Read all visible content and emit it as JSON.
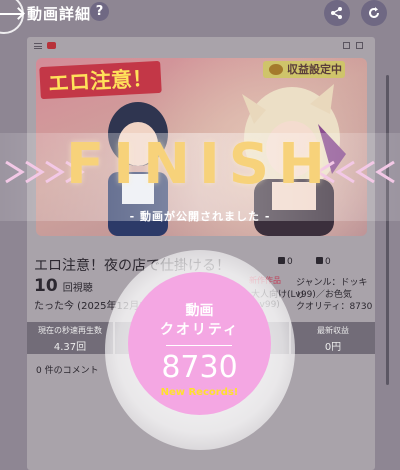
{
  "header": {
    "title": "動画詳細",
    "help_label": "?"
  },
  "video": {
    "thumbnail_banner": "エロ注意！",
    "monetize_badge": "収益設定中",
    "title": "エロ注意！夜の店で仕掛ける！",
    "views_count": "10",
    "views_label": "回視聴",
    "posted_time": "たった今 (2025年12月12日)",
    "likes": "0",
    "dislikes": "0",
    "badge_text": "新作作品",
    "genre": "ジャンル：ドッキリ",
    "rank": "大人向け(Lv99)／お色気(Lv99)",
    "quality": "クオリティ：8730"
  },
  "stats": [
    {
      "label": "現在の秒速再生数",
      "value": "4.37回"
    },
    {
      "label": "",
      "value": ""
    },
    {
      "label": "",
      "value": ""
    },
    {
      "label": "最新収益",
      "value": "0円"
    }
  ],
  "comments": {
    "count_label": "0 件のコメント"
  },
  "finish": {
    "title": "FINISH",
    "subtitle": "- 動画が公開されました -"
  },
  "result": {
    "label_line1": "動画",
    "label_line2": "クオリティ",
    "value": "8730",
    "record_text": "New Records!"
  },
  "colors": {
    "background": "#8e8693",
    "finish_gold": "#f7d27a",
    "quality_pink": "#f4a7e3",
    "record_yellow": "#ffe02e",
    "banner_red": "#c33747"
  },
  "icons": [
    "back-arrow-icon",
    "help-icon",
    "share-icon",
    "refresh-icon",
    "menu-icon",
    "play-icon",
    "thumb-up-icon",
    "thumb-down-icon",
    "coin-icon"
  ]
}
